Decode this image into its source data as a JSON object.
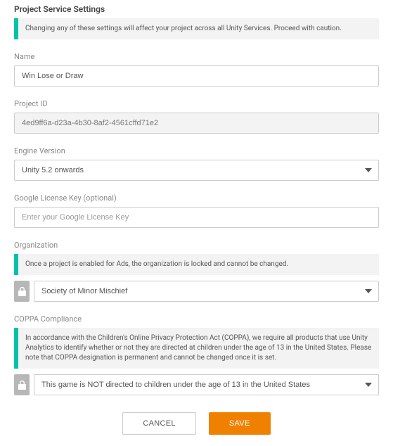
{
  "title": "Project Service Settings",
  "topWarning": "Changing any of these settings will affect your project across all Unity Services. Proceed with caution.",
  "fields": {
    "name": {
      "label": "Name",
      "value": "Win Lose or Draw"
    },
    "projectId": {
      "label": "Project ID",
      "value": "4ed9ff6a-d23a-4b30-8af2-4561cffd71e2"
    },
    "engineVersion": {
      "label": "Engine Version",
      "value": "Unity 5.2 onwards"
    },
    "googleLicenseKey": {
      "label": "Google License Key (optional)",
      "placeholder": "Enter your Google License Key"
    },
    "organization": {
      "label": "Organization",
      "info": "Once a project is enabled for Ads, the organization is locked and cannot be changed.",
      "value": "Society of Minor Mischief"
    },
    "coppa": {
      "label": "COPPA Compliance",
      "info": "In accordance with the Children's Online Privacy Protection Act (COPPA), we require all products that use Unity Analytics to identify whether or not they are directed at children under the age of 13 in the United States. Please note that COPPA designation is permanent and cannot be changed once it is set.",
      "value": "This game is NOT directed to children under the age of 13 in the United States"
    }
  },
  "buttons": {
    "cancel": "CANCEL",
    "save": "SAVE"
  },
  "colors": {
    "accent": "#00c2a6",
    "primary": "#f08100"
  }
}
